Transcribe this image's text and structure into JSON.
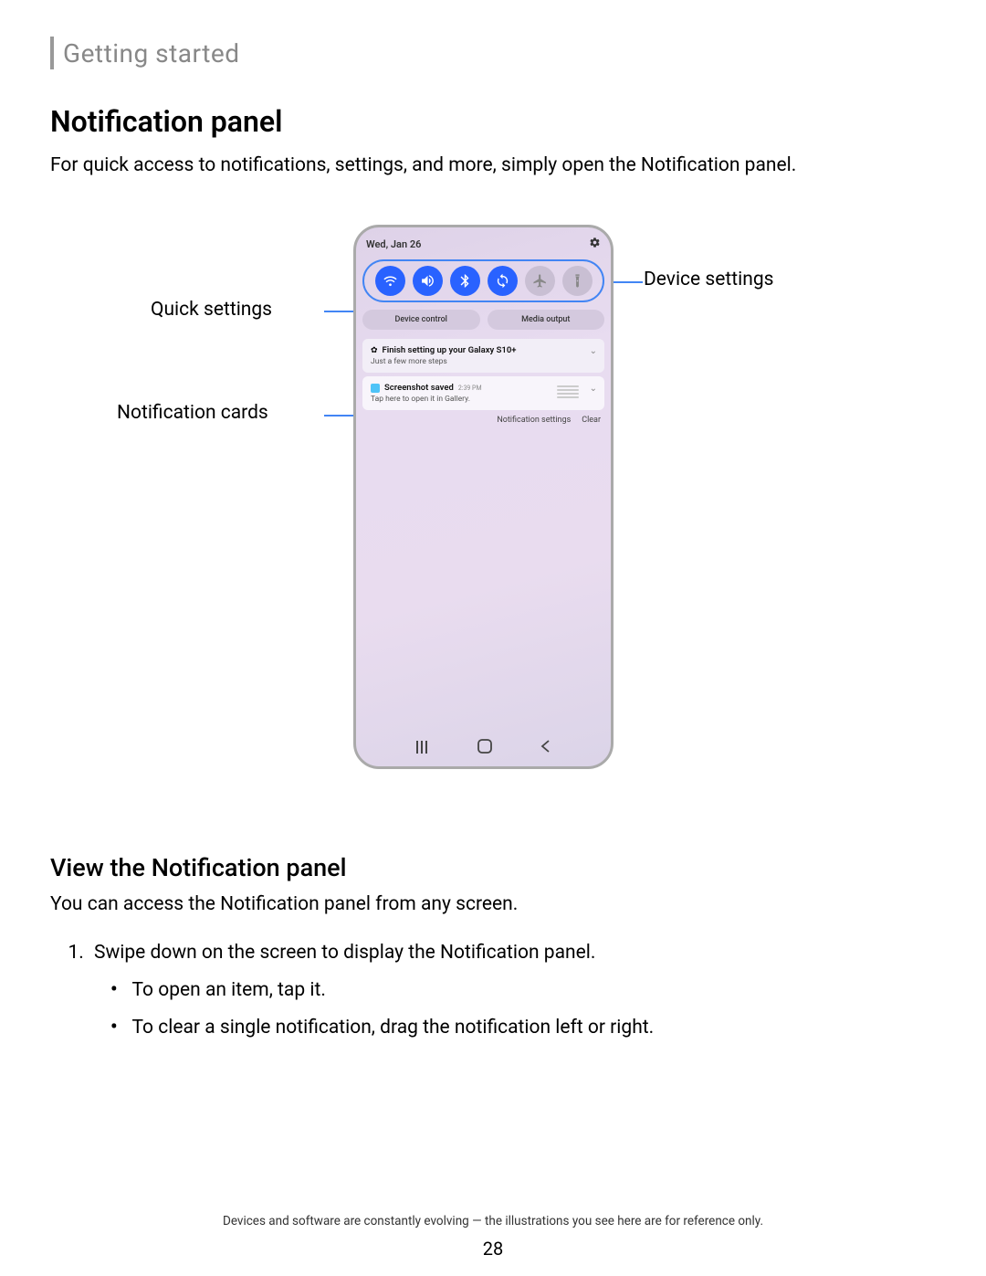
{
  "chapter": "Getting started",
  "section": {
    "title": "Notification panel",
    "desc": "For quick access to notifications, settings, and more, simply open the Notification panel."
  },
  "callouts": {
    "device_settings": "Device settings",
    "quick_settings": "Quick settings",
    "notification_cards": "Notification cards"
  },
  "phone": {
    "date": "Wed, Jan 26",
    "pills": {
      "device_control": "Device control",
      "media_output": "Media output"
    },
    "notif1": {
      "title": "Finish setting up your Galaxy S10+",
      "sub": "Just a few more steps"
    },
    "notif2": {
      "title": "Screenshot saved",
      "time": "2:39 PM",
      "sub": "Tap here to open it in Gallery."
    },
    "footer": {
      "settings": "Notification settings",
      "clear": "Clear"
    }
  },
  "subsection": {
    "title": "View the Notification panel",
    "desc": "You can access the Notification panel from any screen.",
    "step1": "Swipe down on the screen to display the Notification panel.",
    "bullet1": "To open an item, tap it.",
    "bullet2": "To clear a single notification, drag the notification left or right."
  },
  "footer_note": "Devices and software are constantly evolving — the illustrations you see here are for reference only.",
  "page_num": "28"
}
